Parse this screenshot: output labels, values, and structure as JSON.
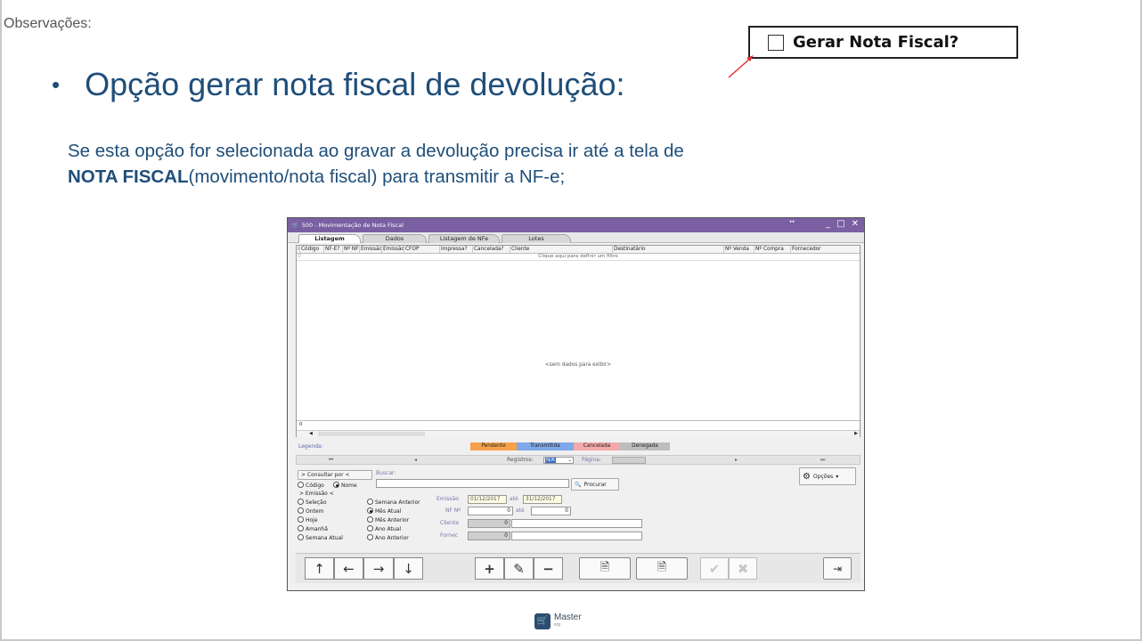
{
  "slide": {
    "observations_label": "Observações:",
    "bullet_title": "Opção gerar nota fiscal de devolução:",
    "description_part1": "Se esta opção for selecionada ao gravar a devolução precisa ir até a tela de",
    "description_bold": "NOTA FISCAL",
    "description_part2": "(movimento/nota fiscal) para transmitir a NF-e;",
    "checkbox_label": "Gerar Nota Fiscal?",
    "footer_logo_text": "Master",
    "footer_logo_sub": "erp"
  },
  "window": {
    "title": "500 - Movimentação de Nota Fiscal",
    "tabs": [
      "Listagem",
      "Dados",
      "Listagem de NFe",
      "Lotes"
    ],
    "columns": [
      "Código",
      "NF-E?",
      "Nº NF",
      "Emissão",
      "Emissão",
      "CFOP",
      "Impressa?",
      "Cancelada?",
      "Cliente",
      "Destinatário",
      "Nº Venda",
      "Nº Compra",
      "Fornecedor"
    ],
    "filter_hint": "Clique aqui para definir um filtro",
    "empty_text": "<sem dados para exibir>",
    "summary_value": "0",
    "legend_label": "Legenda:",
    "legend": [
      {
        "label": "Pendente",
        "color": "#f7a24b"
      },
      {
        "label": "Transmitida",
        "color": "#7fa9e8"
      },
      {
        "label": "Cancelada",
        "color": "#f3a9a9"
      },
      {
        "label": "Denegada",
        "color": "#bdbdbd"
      }
    ],
    "pager": {
      "registros_label": "Registros:",
      "registros_value": "N/A",
      "pagina_label": "Página:"
    },
    "consultar_button": "> Consultar por <",
    "buscar_label": "Buscar:",
    "search_value": "",
    "radio_codigo": "Código",
    "radio_nome": "Nome",
    "emissao_header": "> Emissão <",
    "period_options_left": [
      "Seleção",
      "Ontem",
      "Hoje",
      "Amanhã",
      "Semana Atual"
    ],
    "period_options_right": [
      "Semana Anterior",
      "Mês Atual",
      "Mês Anterior",
      "Ano Atual",
      "Ano Anterior"
    ],
    "selected_period": "Mês Atual",
    "emissao_label": "Emissão",
    "emissao_from": "01/12/2017",
    "ate_label": "até",
    "emissao_to": "31/12/2017",
    "nf_label": "NF Nº",
    "nf_from": "0",
    "nf_to": "0",
    "cliente_label": "Cliente",
    "cliente_code": "0",
    "fornec_label": "Fornec",
    "fornec_code": "0",
    "procurar_button": "Procurar",
    "opcoes_button": "Opções"
  }
}
